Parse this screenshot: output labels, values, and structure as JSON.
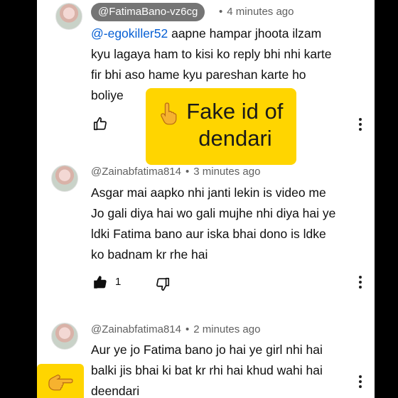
{
  "comments": [
    {
      "handle": "@FatimaBano-vz6cg",
      "time": "4 minutes ago",
      "mention": "@-egokiller52",
      "lines": [
        " aapne hampar jhoota ilzam",
        "kyu lagaya ham to kisi ko reply bhi nhi karte",
        "fir bhi aso hame kyu pareshan karte ho",
        "boliye"
      ]
    },
    {
      "handle": "@Zainabfatima814",
      "time": "3 minutes ago",
      "lines": [
        "Asgar mai aapko nhi janti lekin is video me",
        "Jo gali diya hai wo gali mujhe nhi diya hai ye",
        "ldki Fatima bano aur iska bhai dono is ldke",
        "ko badnam kr rhe hai"
      ],
      "like_count": "1"
    },
    {
      "handle": "@Zainabfatima814",
      "time": "2 minutes ago",
      "lines": [
        "Aur ye jo Fatima bano jo hai ye girl nhi hai",
        "balki jis bhai ki bat kr rhi hai khud wahi hai",
        "deendari"
      ]
    }
  ],
  "callout": {
    "line1": "Fake id of",
    "line2": "dendari"
  },
  "icons": [
    "like-icon",
    "dislike-icon",
    "more-icon",
    "pointing-hand-icon"
  ],
  "colors": {
    "callout": "#ffd500",
    "mention": "#065fd4",
    "handle_pill": "#757575"
  }
}
